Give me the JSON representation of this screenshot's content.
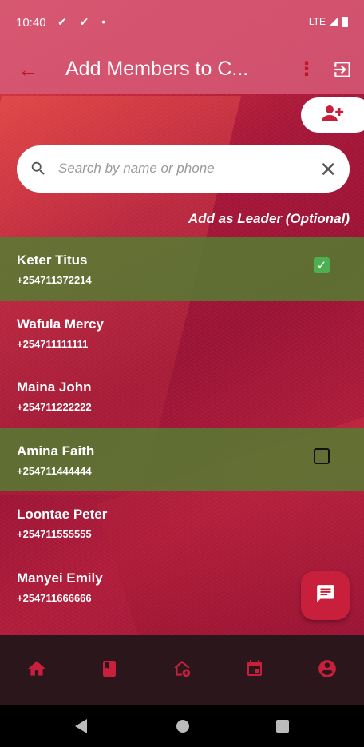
{
  "status_bar": {
    "time": "10:40",
    "notifications": "✔ ✔ •",
    "network": "LTE"
  },
  "app_bar": {
    "title": "Add Members to C...",
    "back_icon": "arrow-back-icon",
    "menu_icon": "more-vert-icon",
    "logout_icon": "logout-icon"
  },
  "add_person_icon": "person-add-icon",
  "search": {
    "placeholder": "Search by name or phone",
    "value": ""
  },
  "leader_hint": "Add as Leader (Optional)",
  "members": [
    {
      "name": "Keter Titus",
      "phone": "+254711372214",
      "selected": true,
      "leader_checked": true
    },
    {
      "name": "Wafula Mercy",
      "phone": "+254711111111",
      "selected": false
    },
    {
      "name": "Maina John",
      "phone": "+254711222222",
      "selected": false
    },
    {
      "name": "Amina Faith",
      "phone": "+254711444444",
      "selected": true,
      "leader_checked": false
    },
    {
      "name": "Loontae Peter",
      "phone": "+254711555555",
      "selected": false
    },
    {
      "name": "Manyei Emily",
      "phone": "+254711666666",
      "selected": false
    }
  ],
  "fab_icon": "chat-icon",
  "bottom_nav": [
    {
      "icon": "home-icon"
    },
    {
      "icon": "book-icon"
    },
    {
      "icon": "add-home-icon"
    },
    {
      "icon": "calendar-icon"
    },
    {
      "icon": "account-icon"
    }
  ],
  "colors": {
    "accent": "#c8203c",
    "selected_row": "#557d32",
    "checkbox_checked": "#4caf50",
    "nav_bg": "#2b161b"
  }
}
